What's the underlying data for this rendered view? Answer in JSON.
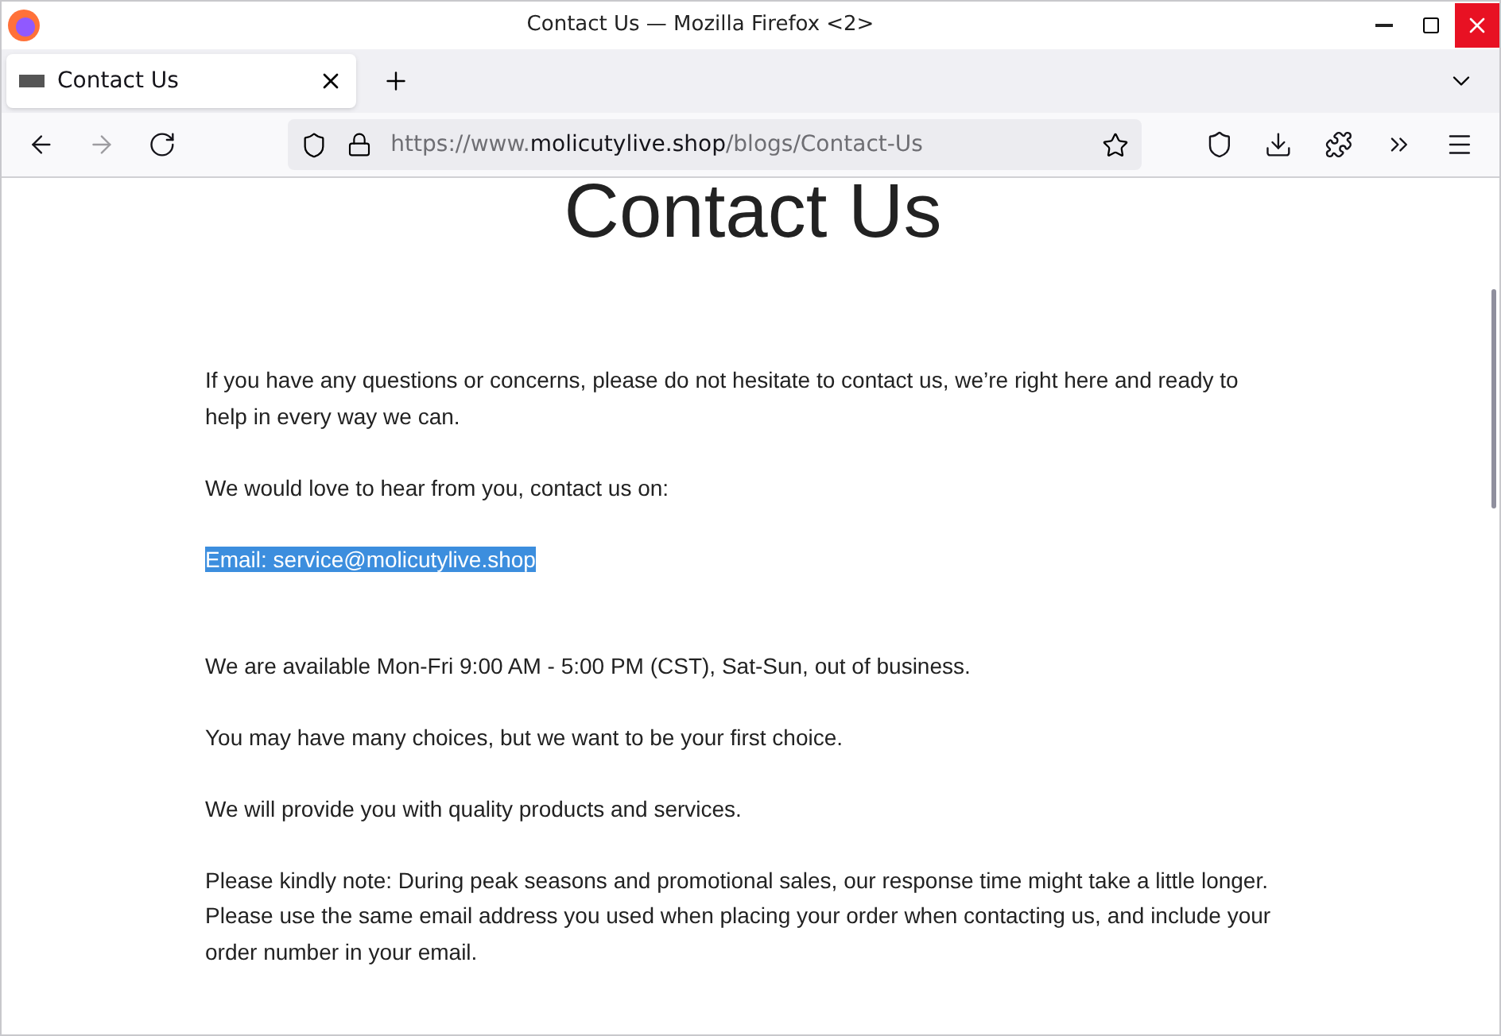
{
  "window": {
    "title": "Contact Us — Mozilla Firefox <2>"
  },
  "tabs": [
    {
      "label": "Contact Us",
      "selected": true
    }
  ],
  "address": {
    "prefix": "https://www.",
    "domain": "molicutylive.shop",
    "path": "/blogs/Contact-Us"
  },
  "page": {
    "heading": "Contact Us",
    "blocks": [
      {
        "kind": "para",
        "text": "If you have any questions or concerns, please do not hesitate to contact us, we’re right here and ready to help in every way we can."
      },
      {
        "kind": "para",
        "text": "We would love to hear from you, contact us on:"
      },
      {
        "kind": "email",
        "text": "Email: service@molicutylive.shop",
        "selected": true
      },
      {
        "kind": "para",
        "text": "We are available Mon-Fri 9:00 AM - 5:00 PM (CST), Sat-Sun, out of business."
      },
      {
        "kind": "para",
        "text": "You may have many choices, but we want to be your first choice."
      },
      {
        "kind": "para",
        "text": "We will provide you with quality products and services."
      },
      {
        "kind": "para",
        "text": "Please kindly note: During peak seasons and promotional sales, our response time might take a little longer. Please use the same email address you used when placing your order when contacting us, and include your order number in your email."
      }
    ]
  }
}
